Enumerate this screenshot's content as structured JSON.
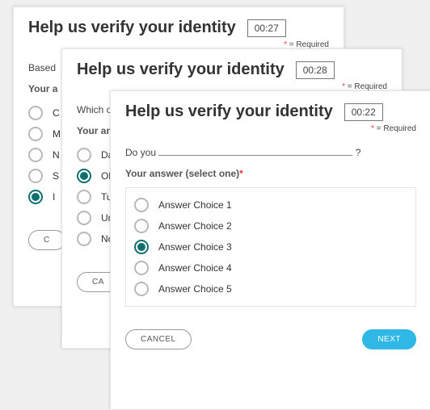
{
  "required_label": "= Required",
  "instr_label": "Your answer (select one)",
  "cancel_label": "CANCEL",
  "next_label": "NEXT",
  "cards": [
    {
      "title": "Help us verify your identity",
      "timer": "00:27",
      "question_prefix": "Based",
      "instr_short": "Your a",
      "options": [
        "C",
        "M",
        "N",
        "S",
        "I"
      ],
      "selected": 4
    },
    {
      "title": "Help us verify your identity",
      "timer": "00:28",
      "question_prefix": "Which of",
      "instr_short": "Your ans",
      "options": [
        "Da",
        "Ob",
        "Tu",
        "Uni",
        "No"
      ],
      "selected": 1
    },
    {
      "title": "Help us verify your identity",
      "timer": "00:22",
      "question_prefix": "Do you",
      "question_suffix": "?",
      "options": [
        "Answer Choice 1",
        "Answer Choice 2",
        "Answer Choice 3",
        "Answer Choice 4",
        "Answer Choice 5"
      ],
      "selected": 2
    }
  ]
}
